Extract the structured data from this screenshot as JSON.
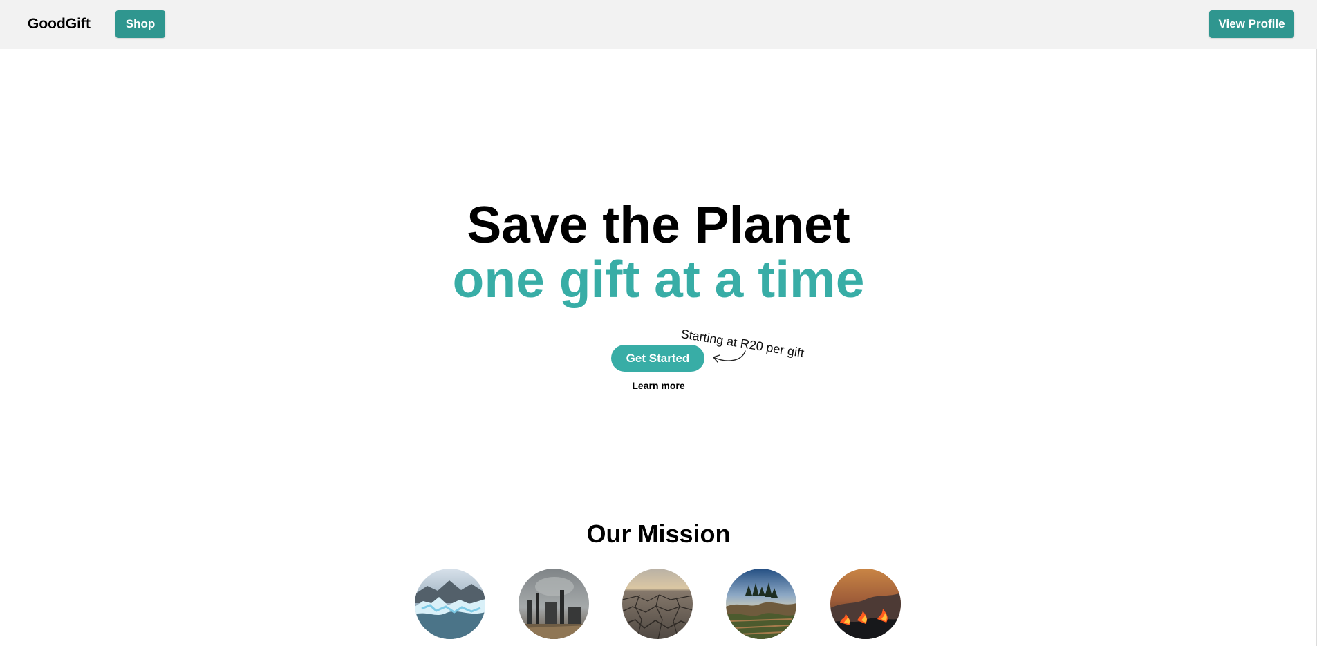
{
  "navbar": {
    "brand": "GoodGift",
    "shop_label": "Shop",
    "profile_label": "View Profile"
  },
  "hero": {
    "title_line1": "Save the Planet",
    "title_line2": "one gift at a time",
    "price_note": "Starting at R20 per gift",
    "cta_label": "Get Started",
    "learn_more": "Learn more"
  },
  "mission": {
    "title": "Our Mission",
    "images": [
      "melting-glacier-image",
      "industrial-pollution-image",
      "cracked-drought-earth-image",
      "deforestation-image",
      "wildfire-image"
    ]
  },
  "colors": {
    "nav_background": "#f2f2f2",
    "button_dark_teal": "#2f968f",
    "accent_teal": "#38ada6",
    "text": "#000000"
  }
}
